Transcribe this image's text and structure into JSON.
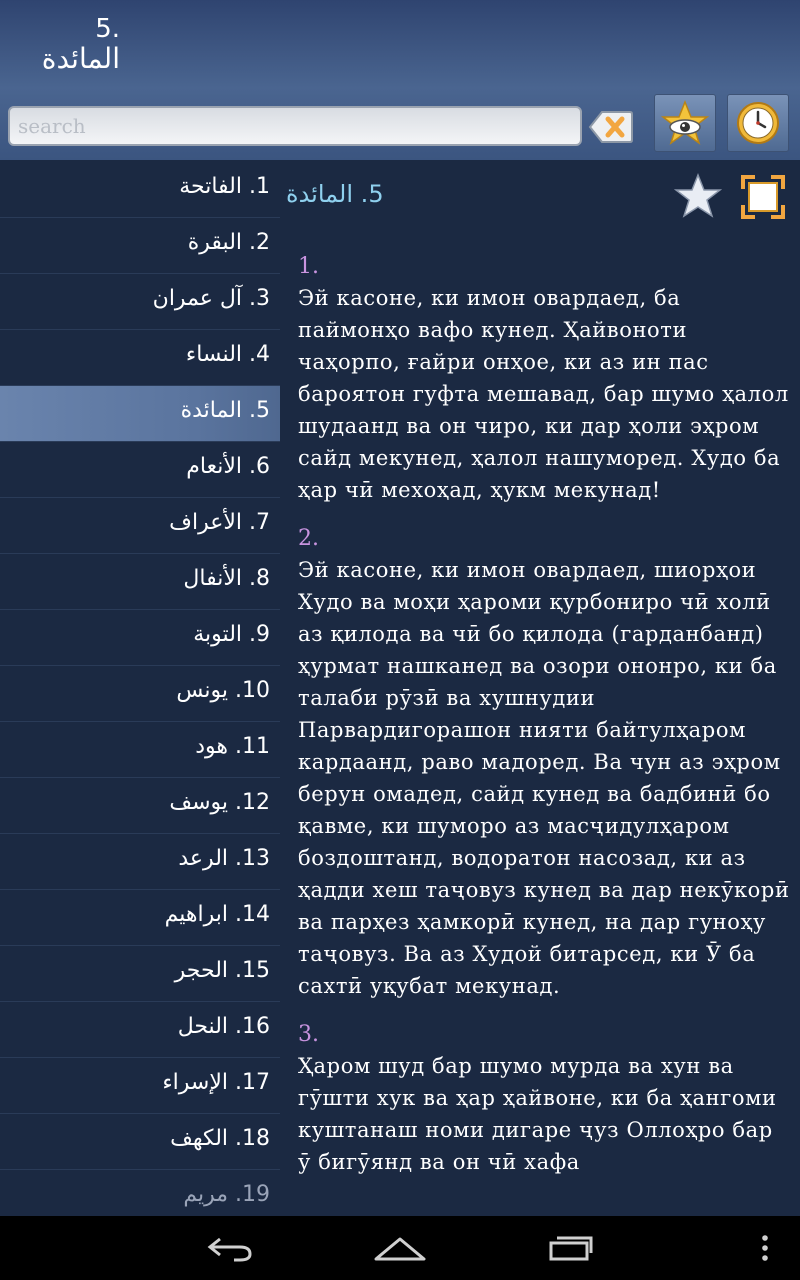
{
  "header": {
    "number": "5.",
    "name": "المائدة"
  },
  "search": {
    "placeholder": "search",
    "value": ""
  },
  "icons": {
    "clear": "clear-search-icon",
    "favorites": "favorites-star-eye-icon",
    "history": "clock-icon",
    "star": "star-icon",
    "fullscreen": "fullscreen-icon"
  },
  "sidebar": {
    "items": [
      {
        "label": "1. الفاتحة"
      },
      {
        "label": "2. البقرة"
      },
      {
        "label": "3. آل عمران"
      },
      {
        "label": "4. النساء"
      },
      {
        "label": "5. المائدة"
      },
      {
        "label": "6. الأنعام"
      },
      {
        "label": "7. الأعراف"
      },
      {
        "label": "8. الأنفال"
      },
      {
        "label": "9. التوبة"
      },
      {
        "label": "10. يونس"
      },
      {
        "label": "11. هود"
      },
      {
        "label": "12. يوسف"
      },
      {
        "label": "13. الرعد"
      },
      {
        "label": "14. ابراهيم"
      },
      {
        "label": "15. الحجر"
      },
      {
        "label": "16. النحل"
      },
      {
        "label": "17. الإسراء"
      },
      {
        "label": "18. الكهف"
      },
      {
        "label": "19. مريم"
      }
    ],
    "selected_index": 4
  },
  "content": {
    "title_number": "5.",
    "title_name": "المائدة",
    "verses": [
      {
        "number": "1.",
        "text": "Эй касоне, ки имон овардаед, ба паймонҳо вафо кунед. Ҳайвоноти чаҳорпо, ғайри онҳое, ки аз ин пас бароятон гуфта мешавад, бар шумо ҳалол шудаанд ва он чиро, ки дар ҳоли эҳром сайд мекунед, ҳалол нашуморед. Худо ба ҳар чӣ мехоҳад, ҳукм мекунад!"
      },
      {
        "number": "2.",
        "text": "Эй касоне, ки имон овардаед, шиорҳои Худо ва моҳи ҳароми қурбониро чӣ холӣ аз қилода ва чӣ бо қилода (гарданбанд) ҳурмат нашканед ва озори ононро, ки ба талаби рӯзӣ ва хушнудии Парвардигорашон нияти байтулҳаром кардаанд, раво мадоред. Ва чун аз эҳром берун омадед, сайд кунед ва бадбинӣ бо қавме, ки шуморо аз масҷидулҳаром боздоштанд, водоратон насозад, ки аз ҳадди хеш таҷовуз кунед ва дар некӯкорӣ ва парҳез ҳамкорӣ кунед, на дар гуноҳу таҷовуз. Ва аз Худой битарсед, ки Ӯ ба сахтӣ уқубат мекунад."
      },
      {
        "number": "3.",
        "text": "Ҳаром шуд бар шумо мурда ва хун ва гӯшти хук ва ҳар ҳайвоне, ки ба ҳангоми куштанаш номи дигаре ҷуз Оллоҳро бар ӯ бигӯянд ва он чӣ хафа"
      }
    ]
  },
  "navbar": {
    "back": "back-icon",
    "home": "home-icon",
    "recents": "recent-apps-icon",
    "menu": "overflow-menu-icon"
  }
}
